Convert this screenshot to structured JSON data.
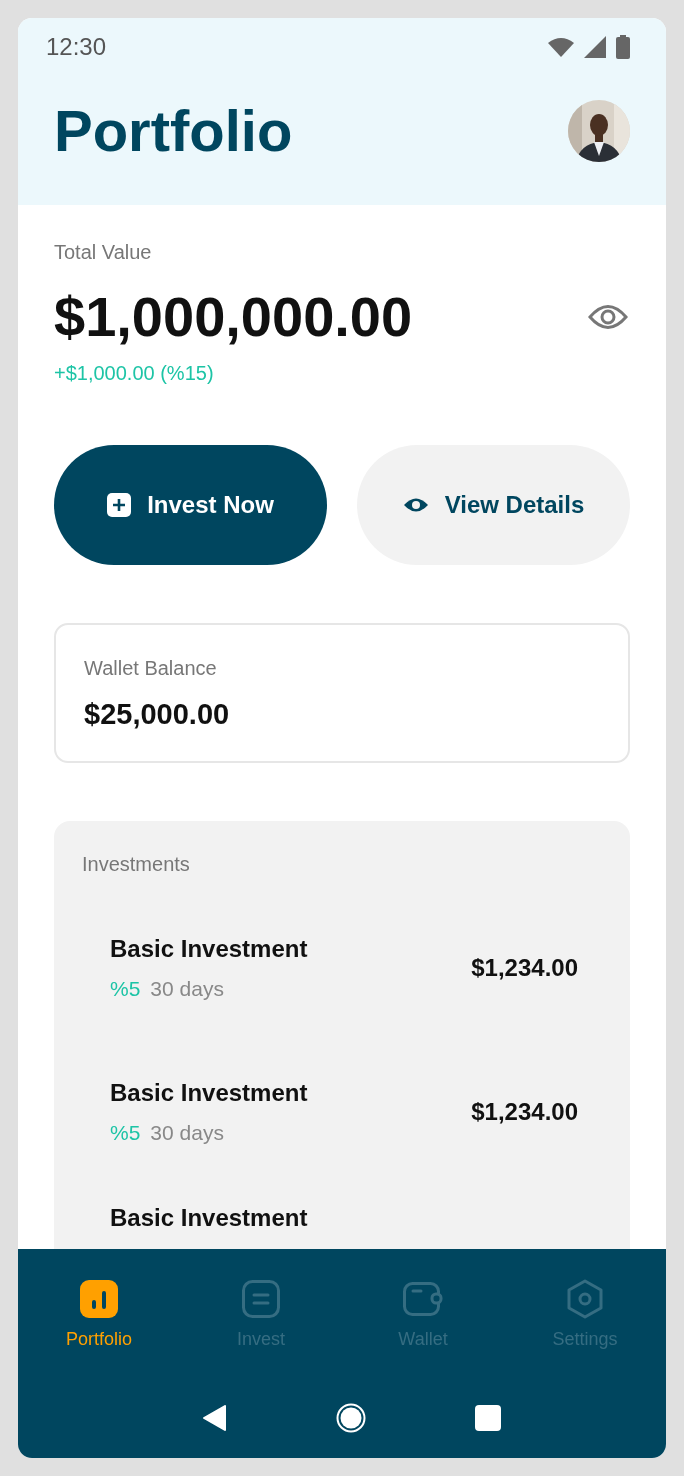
{
  "status_bar": {
    "time": "12:30"
  },
  "header": {
    "title": "Portfolio"
  },
  "total": {
    "label": "Total Value",
    "amount": "$1,000,000.00",
    "change": "+$1,000.00 (%15)"
  },
  "actions": [
    {
      "label": "Invest Now",
      "kind": "primary"
    },
    {
      "label": "View Details",
      "kind": "secondary"
    }
  ],
  "wallet": {
    "label": "Wallet Balance",
    "amount": "$25,000.00"
  },
  "investments": {
    "title": "Investments",
    "items": [
      {
        "name": "Basic Investment",
        "rate": "%5",
        "term": "30 days",
        "amount": "$1,234.00"
      },
      {
        "name": "Basic Investment",
        "rate": "%5",
        "term": "30 days",
        "amount": "$1,234.00"
      },
      {
        "name": "Basic Investment"
      }
    ]
  },
  "tabs": [
    {
      "label": "Portfolio",
      "kind": "chart",
      "selected": true
    },
    {
      "label": "Invest",
      "kind": "list",
      "selected": false
    },
    {
      "label": "Wallet",
      "kind": "wallet",
      "selected": false
    },
    {
      "label": "Settings",
      "kind": "settings",
      "selected": false
    }
  ]
}
